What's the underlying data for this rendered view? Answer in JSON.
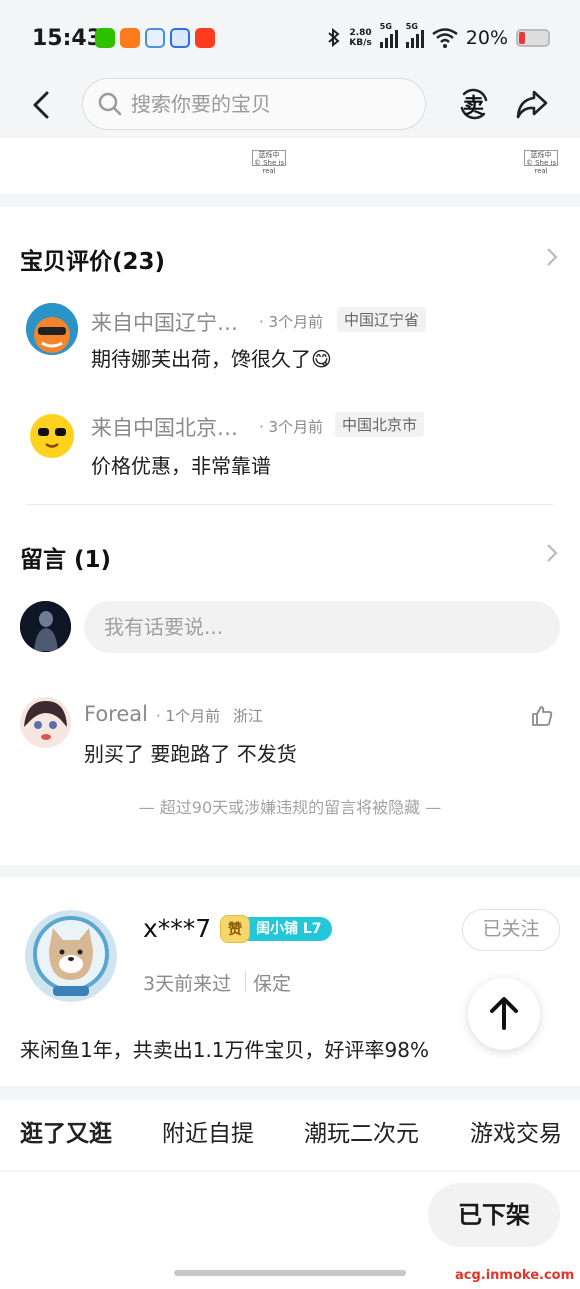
{
  "status_bar": {
    "time": "15:43",
    "net_speed": "2.80",
    "net_unit": "KB/s",
    "net_type_1": "5G",
    "net_type_2": "5G",
    "battery": "20%"
  },
  "nav": {
    "search_placeholder": "搜索你要的宝贝",
    "sell_label": "卖"
  },
  "reviews": {
    "title": "宝贝评价(23)",
    "items": [
      {
        "user": "来自中国辽宁…",
        "time": "· 3个月前",
        "region": "中国辽宁省",
        "text": "期待娜芙出荷，馋很久了😋"
      },
      {
        "user": "来自中国北京…",
        "time": "· 3个月前",
        "region": "中国北京市",
        "text": "价格优惠，非常靠谱"
      }
    ]
  },
  "messages": {
    "title": "留言 (1)",
    "input_placeholder": "我有话要说...",
    "items": [
      {
        "user": "Foreal",
        "time": "· 1个月前",
        "region": "浙江",
        "text": "别买了 要跑路了 不发货"
      }
    ],
    "notice": "— 超过90天或涉嫌违规的留言将被隐藏 —"
  },
  "seller": {
    "name": "x***7",
    "badge_zan": "赞",
    "badge_level": "闺小铺 L7",
    "follow_label": "已关注",
    "last_visit": "3天前来过",
    "location": "保定",
    "summary": "来闲鱼1年，共卖出1.1万件宝贝，好评率98%"
  },
  "tabs": [
    "逛了又逛",
    "附近自提",
    "潮玩二次元",
    "游戏交易"
  ],
  "footer": {
    "off_shelf_label": "已下架",
    "site": "acg.inmoke.com"
  },
  "watermark": {
    "line1": "蓝烁中",
    "line2": "© She is real"
  }
}
